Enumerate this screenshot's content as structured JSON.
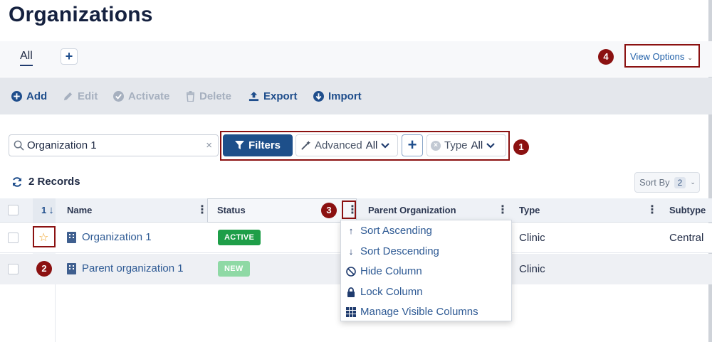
{
  "page": {
    "title": "Organizations"
  },
  "views": {
    "active_tab": "All",
    "add_label": "+",
    "view_options_label": "View Options"
  },
  "toolbar": {
    "add": "Add",
    "edit": "Edit",
    "activate": "Activate",
    "delete": "Delete",
    "export": "Export",
    "import": "Import"
  },
  "search": {
    "value": "Organization 1",
    "clear": "×"
  },
  "filters": {
    "filters_label": "Filters",
    "advanced_label": "Advanced",
    "advanced_value": "All",
    "add_label": "+",
    "type_label": "Type",
    "type_value": "All"
  },
  "records": {
    "label": "2 Records"
  },
  "sort": {
    "label": "Sort By",
    "count": "2"
  },
  "grid": {
    "sort_index": "1",
    "columns": [
      "Name",
      "Status",
      "Parent Organization",
      "Type",
      "Subtype"
    ],
    "rows": [
      {
        "name": "Organization 1",
        "status": "ACTIVE",
        "status_color": "#1e9e48",
        "parent": "",
        "type": "Clinic",
        "subtype": "Central",
        "starred": false
      },
      {
        "name": "Parent organization 1",
        "status": "NEW",
        "status_color": "#8fd9a5",
        "parent": "",
        "type": "Clinic",
        "subtype": ""
      }
    ]
  },
  "column_menu": {
    "items": [
      {
        "label": "Sort Ascending",
        "icon": "arrow-up-icon"
      },
      {
        "label": "Sort Descending",
        "icon": "arrow-down-icon"
      },
      {
        "label": "Hide Column",
        "icon": "ban-icon"
      },
      {
        "label": "Lock Column",
        "icon": "lock-icon"
      },
      {
        "label": "Manage Visible Columns",
        "icon": "grid-icon"
      }
    ]
  },
  "callouts": [
    "1",
    "2",
    "3",
    "4"
  ],
  "colors": {
    "primary": "#1d4f8a",
    "callout": "#8b1111",
    "link": "#2e5a94"
  }
}
